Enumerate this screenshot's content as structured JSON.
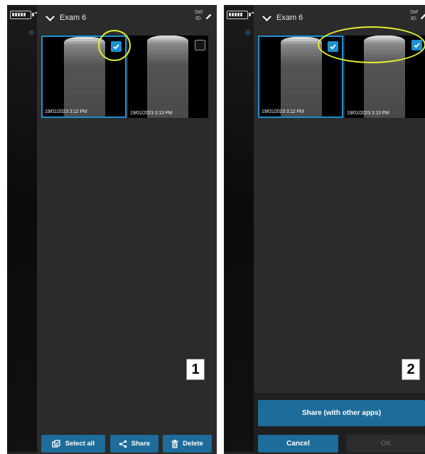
{
  "colors": {
    "accent": "#1d8fd0",
    "button": "#1d6c99",
    "highlight_ring": "#e4ee2a"
  },
  "panel1": {
    "header": {
      "exam_title": "Exam 6",
      "def_label": "Def",
      "id_label": "ID:"
    },
    "thumbnails": [
      {
        "timestamp": "19/01/2023 3:12 PM",
        "checked": true
      },
      {
        "timestamp": "19/01/2023 3:13 PM",
        "checked": false
      }
    ],
    "step_label": "1",
    "toolbar": {
      "select_all": "Select all",
      "share": "Share",
      "delete": "Delete"
    }
  },
  "panel2": {
    "header": {
      "exam_title": "Exam 6",
      "def_label": "Def",
      "id_label": "ID:"
    },
    "thumbnails": [
      {
        "timestamp": "19/01/2023 3:12 PM",
        "checked": true
      },
      {
        "timestamp": "19/01/2023 3:13 PM",
        "checked": true
      }
    ],
    "step_label": "2",
    "share_sheet": {
      "share_apps": "Share (with other apps)",
      "cancel": "Cancel",
      "ok": "OK"
    }
  }
}
